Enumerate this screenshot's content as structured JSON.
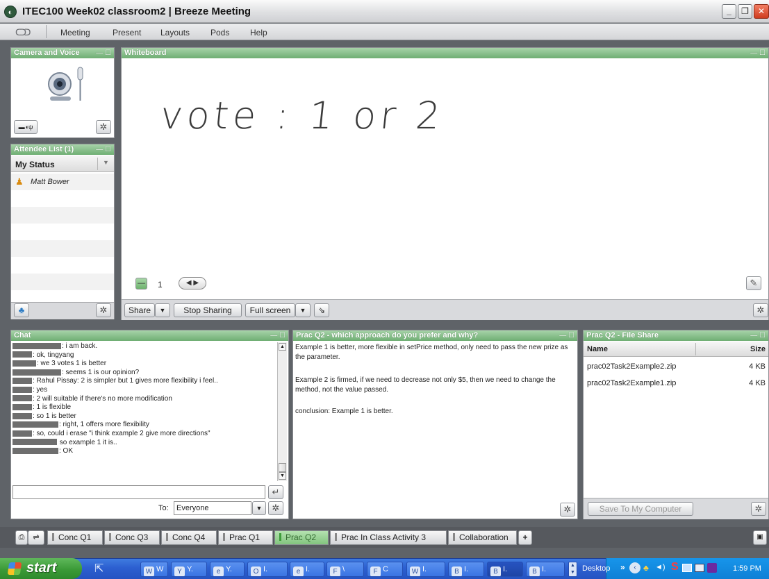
{
  "window": {
    "title": "ITEC100 Week02 classroom2 | Breeze Meeting",
    "app_icon": "breeze-icon"
  },
  "menu": {
    "logo": "breeze-logo",
    "items": [
      "Meeting",
      "Present",
      "Layouts",
      "Pods",
      "Help"
    ]
  },
  "camera_pod": {
    "title": "Camera and Voice"
  },
  "attendee_pod": {
    "title": "Attendee List (1)",
    "column": "My Status",
    "attendees": [
      {
        "name": "Matt Bower",
        "role_icon": "host-icon"
      }
    ]
  },
  "whiteboard": {
    "title": "Whiteboard",
    "handwriting": "vote : 1 or 2",
    "page_number": "1",
    "share_label": "Share",
    "stop_sharing_label": "Stop Sharing",
    "fullscreen_label": "Full screen"
  },
  "chat": {
    "title": "Chat",
    "lines": [
      {
        "redact": 70,
        "text": ": i am back."
      },
      {
        "redact": 28,
        "text": ": ok, tingyang"
      },
      {
        "redact": 34,
        "text": ": we 3 votes 1 is better"
      },
      {
        "redact": 70,
        "text": ": seems 1 is our opinion?"
      },
      {
        "redact": 28,
        "text": ": Rahul Pissay: 2 is simpler but 1 gives more flexibility i feel.."
      },
      {
        "redact": 28,
        "text": ": yes"
      },
      {
        "redact": 28,
        "text": ": 2 will suitable if there's no more modification"
      },
      {
        "redact": 28,
        "text": ": 1 is flexible"
      },
      {
        "redact": 28,
        "text": ": so 1 is better"
      },
      {
        "redact": 66,
        "text": ": right, 1 offers more flexibility"
      },
      {
        "redact": 28,
        "text": ": so, could i erase \"i think example 2 give more directions\""
      },
      {
        "redact": 64,
        "text": " so example 1 it is.."
      },
      {
        "redact": 66,
        "text": ": OK"
      }
    ],
    "to_label": "To:",
    "to_value": "Everyone"
  },
  "notes_pod": {
    "title": "Prac Q2 - which approach do you prefer and why?",
    "paragraphs": [
      "Example 1 is better, more flexible in setPrice method, only need to pass the new prize as the parameter.",
      "Example 2 is firmed, if we need to decrease not only $5, then we need to change the method, not the value passed.",
      "conclusion: Example 1 is better."
    ]
  },
  "fileshare": {
    "title": "Prac Q2 - File Share",
    "col_name": "Name",
    "col_size": "Size",
    "files": [
      {
        "name": "prac02Task2Example2.zip",
        "size": "4 KB"
      },
      {
        "name": "prac02Task2Example1.zip",
        "size": "4 KB"
      }
    ],
    "save_label": "Save To My Computer"
  },
  "layout_tabs": [
    {
      "label": "Conc Q1",
      "active": false
    },
    {
      "label": "Conc Q3",
      "active": false
    },
    {
      "label": "Conc Q4",
      "active": false
    },
    {
      "label": "Prac Q1",
      "active": false
    },
    {
      "label": "Prac Q2",
      "active": true
    },
    {
      "label": "Prac In Class Activity 3",
      "active": false
    },
    {
      "label": "Collaboration",
      "active": false
    }
  ],
  "add_tab_label": "+",
  "taskbar": {
    "start_label": "start",
    "tasks": [
      {
        "icon": "W",
        "label": "W"
      },
      {
        "icon": "Y",
        "label": "Y."
      },
      {
        "icon": "e",
        "label": "Y."
      },
      {
        "icon": "O",
        "label": "I."
      },
      {
        "icon": "e",
        "label": "I."
      },
      {
        "icon": "F",
        "label": "\\"
      },
      {
        "icon": "F",
        "label": "C"
      },
      {
        "icon": "W",
        "label": "I."
      },
      {
        "icon": "B",
        "label": "I."
      },
      {
        "icon": "B",
        "label": "I."
      },
      {
        "icon": "B",
        "label": "I."
      }
    ],
    "desktop_label": "Desktop",
    "chevron": "»",
    "clock": "1:59 PM"
  },
  "colors": {
    "pod_header": "#7ab77e",
    "active_tab": "#8ec98c",
    "taskbar": "#2c5fd0",
    "start": "#3b9a37"
  }
}
